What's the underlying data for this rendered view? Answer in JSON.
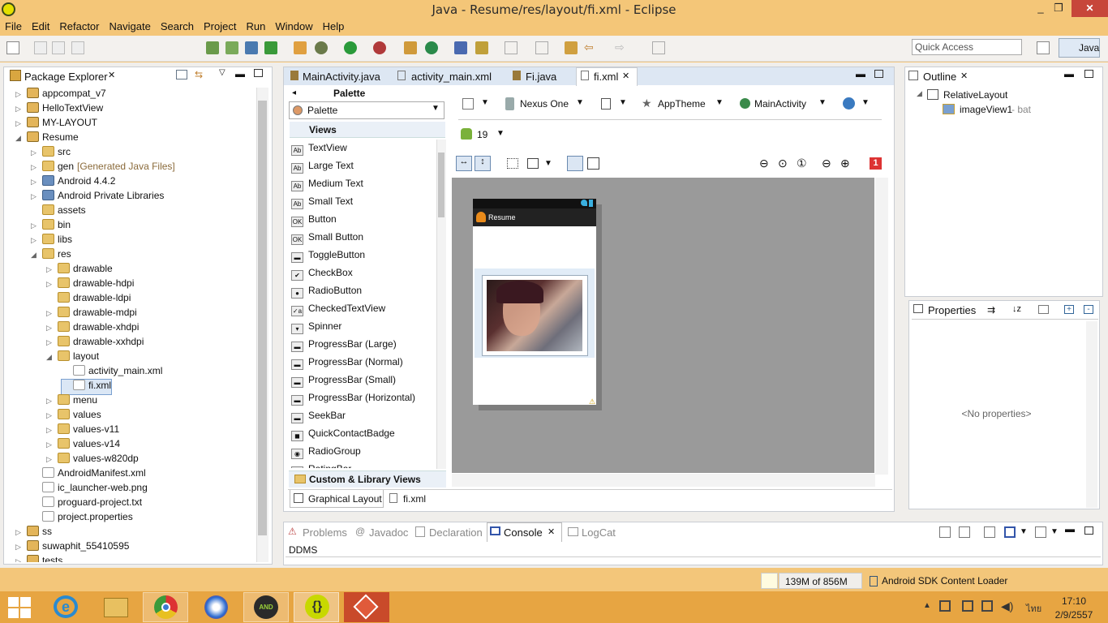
{
  "window": {
    "title": "Java - Resume/res/layout/fi.xml - Eclipse",
    "controls": [
      "_",
      "❐",
      "✕"
    ]
  },
  "menu": [
    "File",
    "Edit",
    "Refactor",
    "Navigate",
    "Search",
    "Project",
    "Run",
    "Window",
    "Help"
  ],
  "toolbar": {
    "quick_access_placeholder": "Quick Access",
    "perspective": "Java"
  },
  "package_explorer": {
    "title": "Package Explorer",
    "items": [
      {
        "label": "appcompat_v7",
        "level": 0,
        "arrow": "▷",
        "type": "proj"
      },
      {
        "label": "HelloTextView",
        "level": 0,
        "arrow": "▷",
        "type": "proj"
      },
      {
        "label": "MY-LAYOUT",
        "level": 0,
        "arrow": "▷",
        "type": "proj"
      },
      {
        "label": "Resume",
        "level": 0,
        "arrow": "◢",
        "type": "proj"
      },
      {
        "label": "src",
        "level": 1,
        "arrow": "▷",
        "type": "folder"
      },
      {
        "label": "gen",
        "suffix": "[Generated Java Files]",
        "level": 1,
        "arrow": "▷",
        "type": "folder"
      },
      {
        "label": "Android 4.4.2",
        "level": 1,
        "arrow": "▷",
        "type": "lib"
      },
      {
        "label": "Android Private Libraries",
        "level": 1,
        "arrow": "▷",
        "type": "lib"
      },
      {
        "label": "assets",
        "level": 1,
        "arrow": "",
        "type": "folder"
      },
      {
        "label": "bin",
        "level": 1,
        "arrow": "▷",
        "type": "folder"
      },
      {
        "label": "libs",
        "level": 1,
        "arrow": "▷",
        "type": "folder"
      },
      {
        "label": "res",
        "level": 1,
        "arrow": "◢",
        "type": "folder"
      },
      {
        "label": "drawable",
        "level": 2,
        "arrow": "▷",
        "type": "folder"
      },
      {
        "label": "drawable-hdpi",
        "level": 2,
        "arrow": "▷",
        "type": "folder"
      },
      {
        "label": "drawable-ldpi",
        "level": 2,
        "arrow": "",
        "type": "folder"
      },
      {
        "label": "drawable-mdpi",
        "level": 2,
        "arrow": "▷",
        "type": "folder"
      },
      {
        "label": "drawable-xhdpi",
        "level": 2,
        "arrow": "▷",
        "type": "folder"
      },
      {
        "label": "drawable-xxhdpi",
        "level": 2,
        "arrow": "▷",
        "type": "folder"
      },
      {
        "label": "layout",
        "level": 2,
        "arrow": "◢",
        "type": "folder"
      },
      {
        "label": "activity_main.xml",
        "level": 3,
        "arrow": "",
        "type": "file"
      },
      {
        "label": "fi.xml",
        "level": 3,
        "arrow": "",
        "type": "file",
        "selected": true
      },
      {
        "label": "menu",
        "level": 2,
        "arrow": "▷",
        "type": "folder"
      },
      {
        "label": "values",
        "level": 2,
        "arrow": "▷",
        "type": "folder"
      },
      {
        "label": "values-v11",
        "level": 2,
        "arrow": "▷",
        "type": "folder"
      },
      {
        "label": "values-v14",
        "level": 2,
        "arrow": "▷",
        "type": "folder"
      },
      {
        "label": "values-w820dp",
        "level": 2,
        "arrow": "▷",
        "type": "folder"
      },
      {
        "label": "AndroidManifest.xml",
        "level": 1,
        "arrow": "",
        "type": "file"
      },
      {
        "label": "ic_launcher-web.png",
        "level": 1,
        "arrow": "",
        "type": "file"
      },
      {
        "label": "proguard-project.txt",
        "level": 1,
        "arrow": "",
        "type": "file"
      },
      {
        "label": "project.properties",
        "level": 1,
        "arrow": "",
        "type": "file"
      },
      {
        "label": "ss",
        "level": 0,
        "arrow": "▷",
        "type": "proj"
      },
      {
        "label": "suwaphit_55410595",
        "level": 0,
        "arrow": "▷",
        "type": "proj"
      },
      {
        "label": "tests",
        "level": 0,
        "arrow": "▷",
        "type": "proj"
      }
    ]
  },
  "editor_tabs": [
    "MainActivity.java",
    "activity_main.xml",
    "Fi.java",
    "fi.xml"
  ],
  "palette": {
    "title": "Palette",
    "dropdown": "Palette",
    "section": "Views",
    "items": [
      {
        "label": "TextView",
        "icon": "Ab"
      },
      {
        "label": "Large Text",
        "icon": "Ab"
      },
      {
        "label": "Medium Text",
        "icon": "Ab"
      },
      {
        "label": "Small Text",
        "icon": "Ab"
      },
      {
        "label": "Button",
        "icon": "OK"
      },
      {
        "label": "Small Button",
        "icon": "OK"
      },
      {
        "label": "ToggleButton",
        "icon": "▬"
      },
      {
        "label": "CheckBox",
        "icon": "✔"
      },
      {
        "label": "RadioButton",
        "icon": "●"
      },
      {
        "label": "CheckedTextView",
        "icon": "✓a"
      },
      {
        "label": "Spinner",
        "icon": "▾"
      },
      {
        "label": "ProgressBar (Large)",
        "icon": "▬"
      },
      {
        "label": "ProgressBar (Normal)",
        "icon": "▬"
      },
      {
        "label": "ProgressBar (Small)",
        "icon": "▬"
      },
      {
        "label": "ProgressBar (Horizontal)",
        "icon": "▬"
      },
      {
        "label": "SeekBar",
        "icon": "▬"
      },
      {
        "label": "QuickContactBadge",
        "icon": "◼"
      },
      {
        "label": "RadioGroup",
        "icon": "◉"
      },
      {
        "label": "RatingBar",
        "icon": "★"
      }
    ],
    "footer_section": "Custom & Library Views"
  },
  "layout_toolbar": {
    "device": "Nexus One",
    "theme": "AppTheme",
    "activity": "MainActivity",
    "api": "19",
    "error_count": "1"
  },
  "preview": {
    "app_title": "Resume"
  },
  "editor_bottom_tabs": [
    "Graphical Layout",
    "fi.xml"
  ],
  "outline": {
    "title": "Outline",
    "root": "RelativeLayout",
    "child": "imageView1",
    "child_suffix": " - bat"
  },
  "properties": {
    "title": "Properties",
    "empty": "<No properties>"
  },
  "bottom_tabs": [
    "Problems",
    "Javadoc",
    "Declaration",
    "Console",
    "LogCat"
  ],
  "console": {
    "text": "DDMS"
  },
  "status": {
    "memory": "139M of 856M",
    "task": "Android SDK Content Loader"
  },
  "taskbar": {
    "time": "17:10",
    "date": "2/9/2557",
    "lang": "ไทย"
  }
}
